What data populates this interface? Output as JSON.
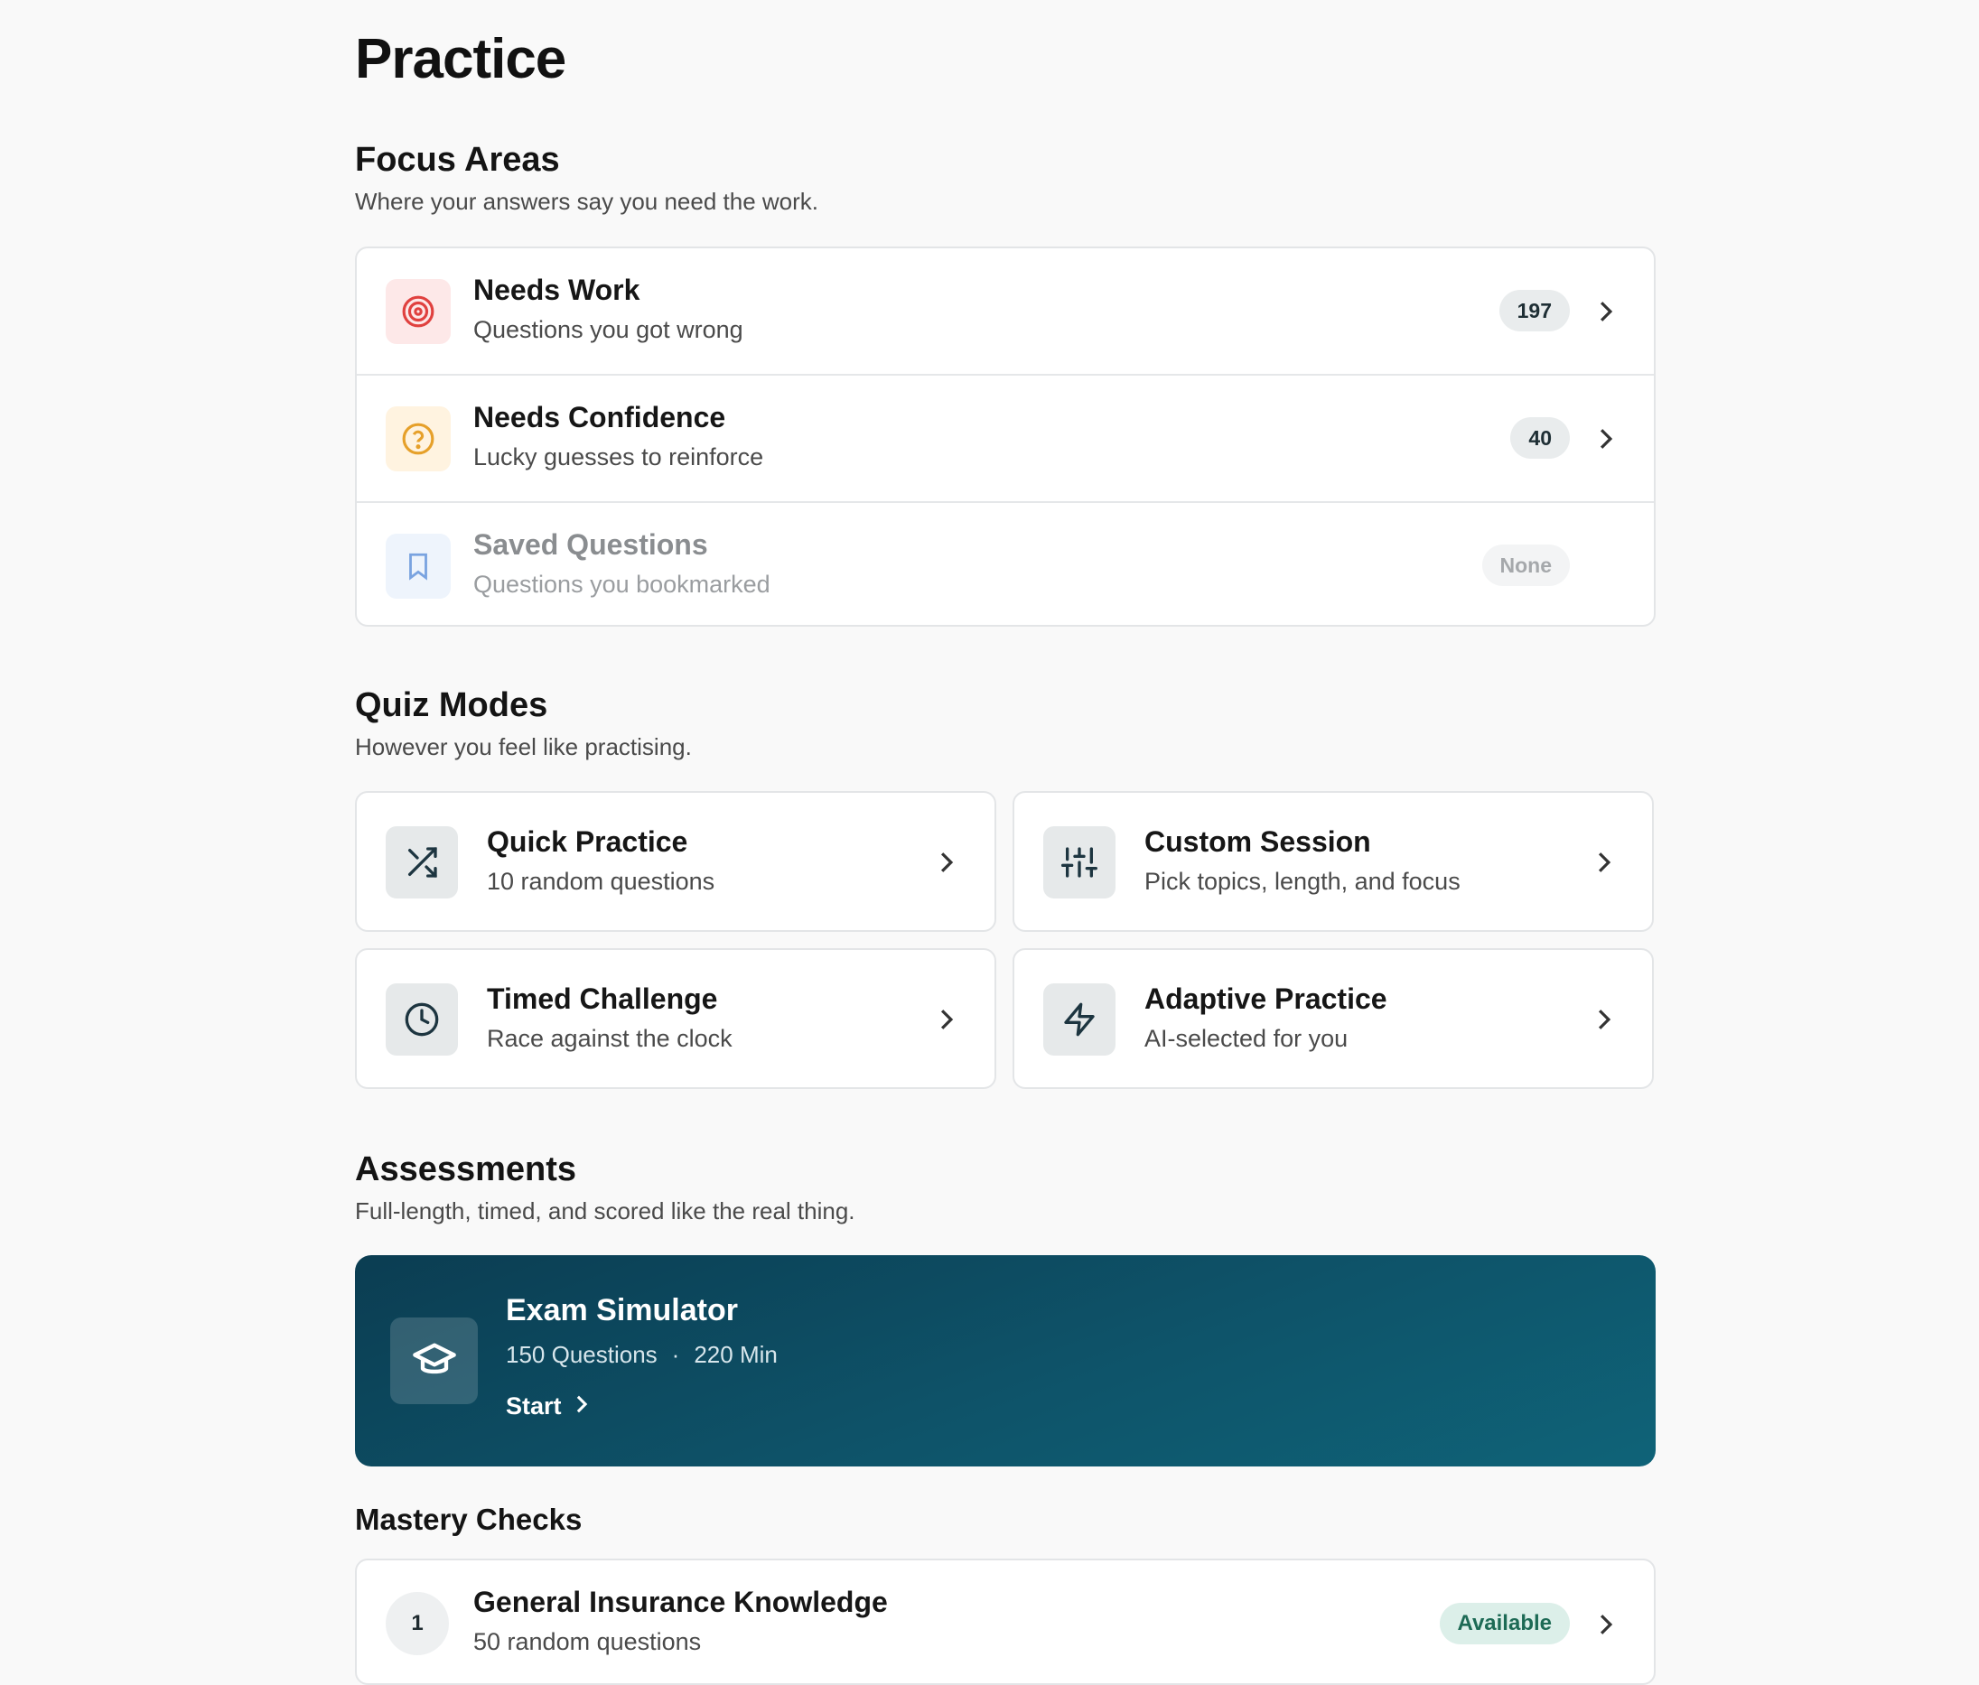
{
  "page": {
    "title": "Practice"
  },
  "focus": {
    "title": "Focus Areas",
    "subtitle": "Where your answers say you need the work.",
    "items": [
      {
        "title": "Needs Work",
        "subtitle": "Questions you got wrong",
        "badge": "197",
        "icon": "target-icon",
        "accent": "#e0413f"
      },
      {
        "title": "Needs Confidence",
        "subtitle": "Lucky guesses to reinforce",
        "badge": "40",
        "icon": "question-circle-icon",
        "accent": "#e6a02a"
      },
      {
        "title": "Saved Questions",
        "subtitle": "Questions you bookmarked",
        "badge": "None",
        "icon": "bookmark-icon",
        "accent": "#7aa3e0"
      }
    ]
  },
  "quiz": {
    "title": "Quiz Modes",
    "subtitle": "However you feel like practising.",
    "modes": [
      {
        "title": "Quick Practice",
        "subtitle": "10 random questions",
        "icon": "shuffle-icon"
      },
      {
        "title": "Custom Session",
        "subtitle": "Pick topics, length, and focus",
        "icon": "sliders-icon"
      },
      {
        "title": "Timed Challenge",
        "subtitle": "Race against the clock",
        "icon": "clock-icon"
      },
      {
        "title": "Adaptive Practice",
        "subtitle": "AI-selected for you",
        "icon": "lightning-icon"
      }
    ]
  },
  "assess": {
    "title": "Assessments",
    "subtitle": "Full-length, timed, and scored like the real thing.",
    "exam": {
      "title": "Exam Simulator",
      "questions": "150 Questions",
      "separator": "·",
      "duration": "220 Min",
      "start": "Start",
      "icon": "graduation-cap-icon"
    }
  },
  "mastery": {
    "title": "Mastery Checks",
    "items": [
      {
        "num": "1",
        "title": "General Insurance Knowledge",
        "subtitle": "50 random questions",
        "status": "Available"
      }
    ]
  },
  "colors": {
    "accent": "#0e5369",
    "available": "#1d6a55"
  }
}
